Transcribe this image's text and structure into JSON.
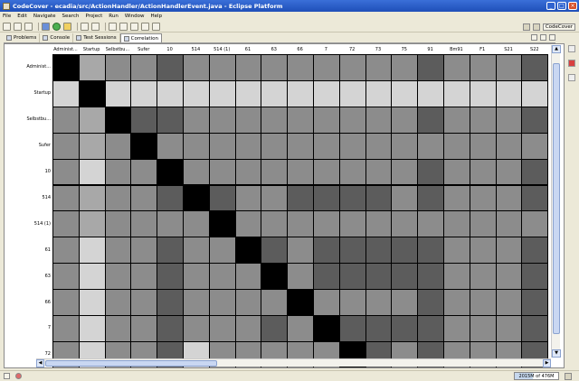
{
  "window": {
    "title": "CodeCover - ecadia/src/ActionHandler/ActionHandlerEvent.java - Eclipse Platform",
    "buttons": [
      "minimize-button",
      "maximize-button",
      "close-button"
    ]
  },
  "menu": [
    "File",
    "Edit",
    "Navigate",
    "Search",
    "Project",
    "Run",
    "Window",
    "Help"
  ],
  "perspective": {
    "label": "CodeCover"
  },
  "tabs": [
    {
      "label": "Problems",
      "active": false
    },
    {
      "label": "Console",
      "active": false
    },
    {
      "label": "Test Sessions",
      "active": false
    },
    {
      "label": "Correlation",
      "active": true
    }
  ],
  "matrix": {
    "columns": [
      "Administ...",
      "Startup",
      "Selbstbu...",
      "Sufer",
      "10",
      "514",
      "514 (1)",
      "61",
      "63",
      "66",
      "7",
      "72",
      "73",
      "75",
      "91",
      "Bm91",
      "F1",
      "S21",
      "S22"
    ],
    "rows": [
      "Administ...",
      "Startup",
      "Selbstbu...",
      "Sufer",
      "10",
      "514",
      "514 (1)",
      "61",
      "63",
      "66",
      "7",
      "72"
    ],
    "grays": [
      [
        "#000000",
        "#a8a8a8",
        "#8c8c8c",
        "#8c8c8c",
        "#5c5c5c",
        "#8c8c8c",
        "#8c8c8c",
        "#8c8c8c",
        "#8c8c8c",
        "#8c8c8c",
        "#8c8c8c",
        "#8c8c8c",
        "#8c8c8c",
        "#8c8c8c",
        "#5c5c5c",
        "#8c8c8c",
        "#8c8c8c",
        "#8c8c8c",
        "#5c5c5c"
      ],
      [
        "#d4d4d4",
        "#000000",
        "#d4d4d4",
        "#d4d4d4",
        "#d4d4d4",
        "#d4d4d4",
        "#d4d4d4",
        "#d4d4d4",
        "#d4d4d4",
        "#d4d4d4",
        "#d4d4d4",
        "#d4d4d4",
        "#d4d4d4",
        "#d4d4d4",
        "#d4d4d4",
        "#d4d4d4",
        "#d4d4d4",
        "#d4d4d4",
        "#d4d4d4"
      ],
      [
        "#8c8c8c",
        "#a8a8a8",
        "#000000",
        "#5c5c5c",
        "#5c5c5c",
        "#8c8c8c",
        "#8c8c8c",
        "#8c8c8c",
        "#8c8c8c",
        "#8c8c8c",
        "#8c8c8c",
        "#8c8c8c",
        "#8c8c8c",
        "#8c8c8c",
        "#5c5c5c",
        "#8c8c8c",
        "#8c8c8c",
        "#8c8c8c",
        "#5c5c5c"
      ],
      [
        "#8c8c8c",
        "#a8a8a8",
        "#8c8c8c",
        "#000000",
        "#8c8c8c",
        "#8c8c8c",
        "#8c8c8c",
        "#8c8c8c",
        "#8c8c8c",
        "#8c8c8c",
        "#8c8c8c",
        "#8c8c8c",
        "#8c8c8c",
        "#8c8c8c",
        "#8c8c8c",
        "#8c8c8c",
        "#8c8c8c",
        "#8c8c8c",
        "#8c8c8c"
      ],
      [
        "#8c8c8c",
        "#d4d4d4",
        "#8c8c8c",
        "#8c8c8c",
        "#000000",
        "#8c8c8c",
        "#8c8c8c",
        "#8c8c8c",
        "#8c8c8c",
        "#8c8c8c",
        "#8c8c8c",
        "#8c8c8c",
        "#8c8c8c",
        "#8c8c8c",
        "#5c5c5c",
        "#8c8c8c",
        "#8c8c8c",
        "#8c8c8c",
        "#5c5c5c"
      ],
      [
        "#8c8c8c",
        "#a8a8a8",
        "#8c8c8c",
        "#8c8c8c",
        "#5c5c5c",
        "#000000",
        "#5c5c5c",
        "#8c8c8c",
        "#8c8c8c",
        "#5c5c5c",
        "#5c5c5c",
        "#5c5c5c",
        "#5c5c5c",
        "#8c8c8c",
        "#5c5c5c",
        "#8c8c8c",
        "#8c8c8c",
        "#8c8c8c",
        "#5c5c5c"
      ],
      [
        "#8c8c8c",
        "#a8a8a8",
        "#8c8c8c",
        "#8c8c8c",
        "#8c8c8c",
        "#8c8c8c",
        "#000000",
        "#8c8c8c",
        "#8c8c8c",
        "#8c8c8c",
        "#8c8c8c",
        "#8c8c8c",
        "#8c8c8c",
        "#8c8c8c",
        "#8c8c8c",
        "#8c8c8c",
        "#8c8c8c",
        "#8c8c8c",
        "#8c8c8c"
      ],
      [
        "#8c8c8c",
        "#d4d4d4",
        "#8c8c8c",
        "#8c8c8c",
        "#5c5c5c",
        "#8c8c8c",
        "#8c8c8c",
        "#000000",
        "#5c5c5c",
        "#8c8c8c",
        "#5c5c5c",
        "#5c5c5c",
        "#5c5c5c",
        "#5c5c5c",
        "#5c5c5c",
        "#8c8c8c",
        "#8c8c8c",
        "#8c8c8c",
        "#5c5c5c"
      ],
      [
        "#8c8c8c",
        "#d4d4d4",
        "#8c8c8c",
        "#8c8c8c",
        "#5c5c5c",
        "#8c8c8c",
        "#8c8c8c",
        "#8c8c8c",
        "#000000",
        "#8c8c8c",
        "#5c5c5c",
        "#5c5c5c",
        "#5c5c5c",
        "#5c5c5c",
        "#5c5c5c",
        "#8c8c8c",
        "#8c8c8c",
        "#8c8c8c",
        "#5c5c5c"
      ],
      [
        "#8c8c8c",
        "#d4d4d4",
        "#8c8c8c",
        "#8c8c8c",
        "#5c5c5c",
        "#8c8c8c",
        "#8c8c8c",
        "#8c8c8c",
        "#8c8c8c",
        "#000000",
        "#8c8c8c",
        "#8c8c8c",
        "#8c8c8c",
        "#8c8c8c",
        "#5c5c5c",
        "#8c8c8c",
        "#8c8c8c",
        "#8c8c8c",
        "#5c5c5c"
      ],
      [
        "#8c8c8c",
        "#d4d4d4",
        "#8c8c8c",
        "#8c8c8c",
        "#5c5c5c",
        "#8c8c8c",
        "#8c8c8c",
        "#8c8c8c",
        "#5c5c5c",
        "#8c8c8c",
        "#000000",
        "#5c5c5c",
        "#5c5c5c",
        "#5c5c5c",
        "#5c5c5c",
        "#8c8c8c",
        "#8c8c8c",
        "#8c8c8c",
        "#5c5c5c"
      ],
      [
        "#8c8c8c",
        "#d4d4d4",
        "#8c8c8c",
        "#8c8c8c",
        "#5c5c5c",
        "#d4d4d4",
        "#8c8c8c",
        "#8c8c8c",
        "#8c8c8c",
        "#8c8c8c",
        "#8c8c8c",
        "#000000",
        "#5c5c5c",
        "#8c8c8c",
        "#5c5c5c",
        "#8c8c8c",
        "#8c8c8c",
        "#8c8c8c",
        "#5c5c5c"
      ]
    ]
  },
  "status": {
    "memory": "2015M of 476M",
    "memory_fraction": 0.42
  }
}
